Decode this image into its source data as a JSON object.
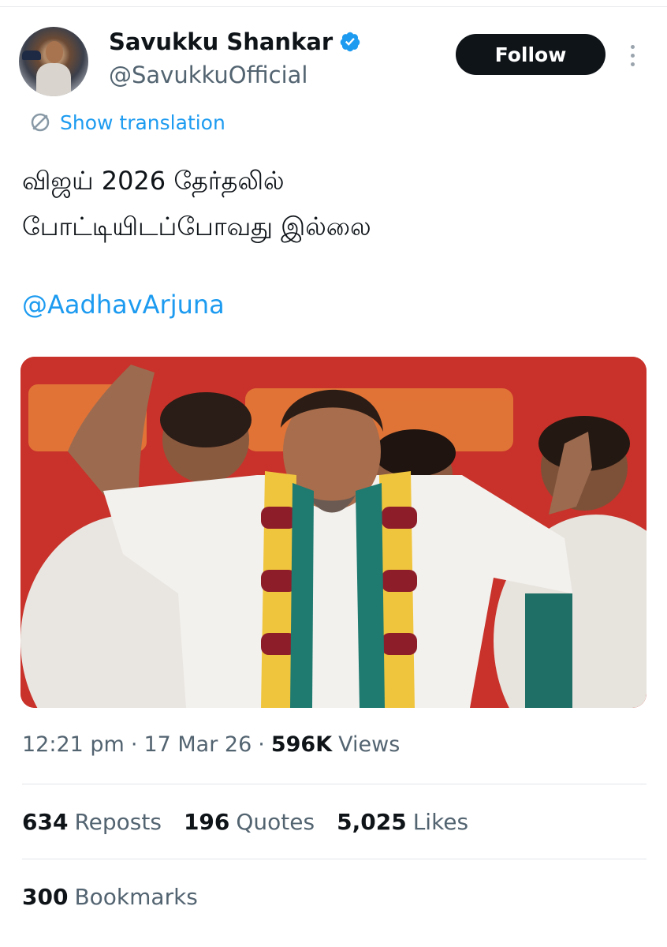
{
  "author": {
    "name": "Savukku Shankar",
    "handle": "@SavukkuOfficial",
    "verified": true,
    "avatar_icon": "profile-photo"
  },
  "actions": {
    "follow_label": "Follow",
    "more_icon": "more-vertical-icon"
  },
  "translate": {
    "label": "Show translation",
    "icon": "translate-icon"
  },
  "tweet": {
    "line1": "விஜய் 2026 தேர்தலில்",
    "line2": "போட்டியிடப்போவது இல்லை",
    "mention": "@AadhavArjuna"
  },
  "meta": {
    "time": "12:21 pm",
    "date": "17 Mar 26",
    "views_count": "596K",
    "views_label": "Views",
    "separator": "·"
  },
  "stats": {
    "reposts_count": "634",
    "reposts_label": "Reposts",
    "quotes_count": "196",
    "quotes_label": "Quotes",
    "likes_count": "5,025",
    "likes_label": "Likes",
    "bookmarks_count": "300",
    "bookmarks_label": "Bookmarks"
  },
  "colors": {
    "accent": "#1d9bf0",
    "text_primary": "#0f1419",
    "text_secondary": "#536471",
    "media_background": "#c8322a"
  }
}
